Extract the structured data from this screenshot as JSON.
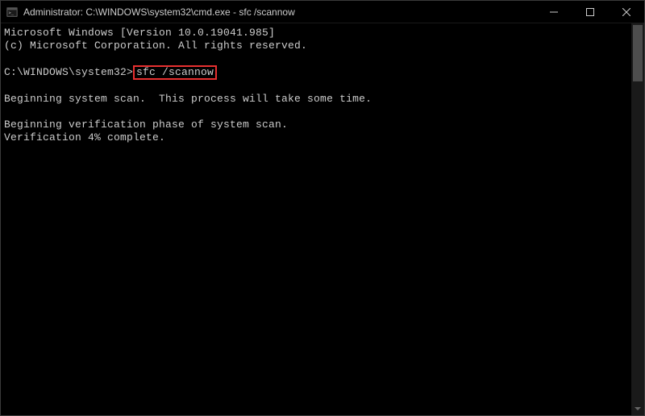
{
  "window": {
    "title": "Administrator: C:\\WINDOWS\\system32\\cmd.exe - sfc  /scannow"
  },
  "terminal": {
    "line1": "Microsoft Windows [Version 10.0.19041.985]",
    "line2": "(c) Microsoft Corporation. All rights reserved.",
    "prompt": "C:\\WINDOWS\\system32>",
    "command": "sfc /scannow",
    "line_scan": "Beginning system scan.  This process will take some time.",
    "line_verify": "Beginning verification phase of system scan.",
    "line_progress": "Verification 4% complete."
  }
}
